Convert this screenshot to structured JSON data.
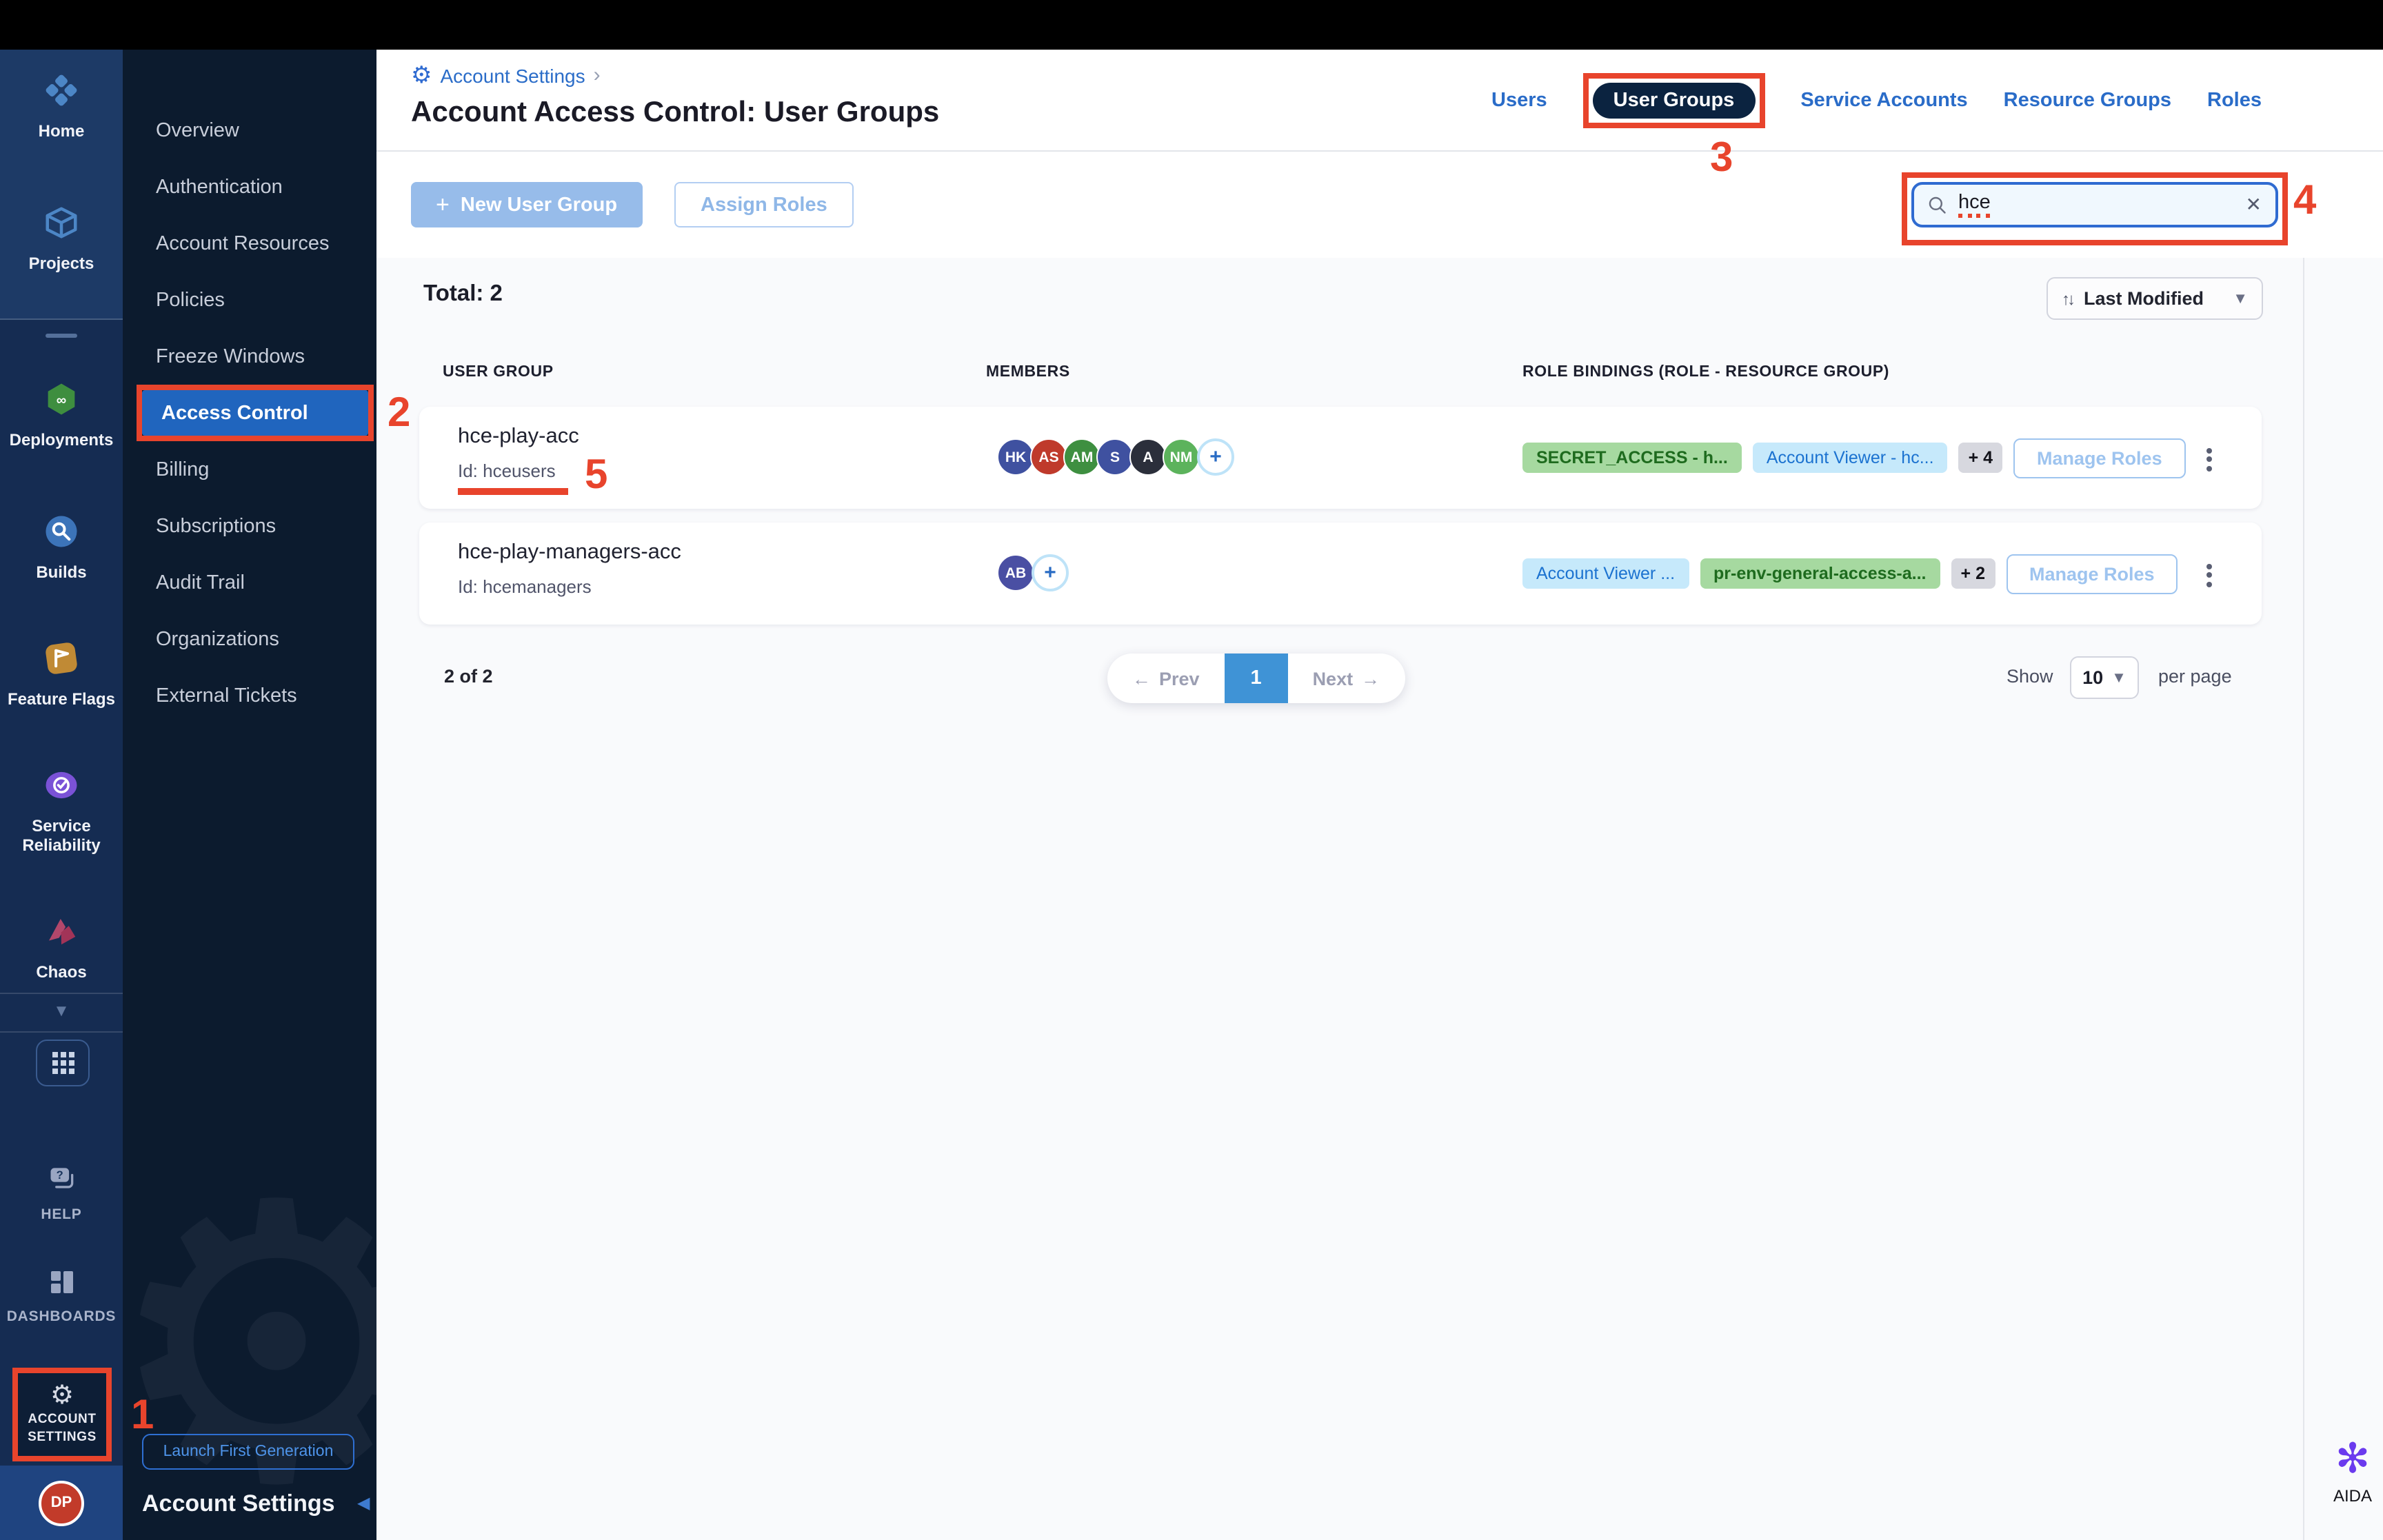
{
  "theme": {
    "annotation_red": "#E8442C",
    "accent_blue": "#2A6CC8",
    "selected_nav_blue": "#2065BE",
    "tab_pill_navy": "#0B2340",
    "chip_green_bg": "#A6D9A0",
    "chip_blue_bg": "#C6E9FB",
    "pagination_active_blue": "#3F93D6"
  },
  "primary_sidebar": {
    "top_items": [
      {
        "label": "Home",
        "icon": "home-icon"
      },
      {
        "label": "Projects",
        "icon": "projects-icon"
      }
    ],
    "module_items": [
      {
        "label": "Deployments",
        "icon": "deployments-icon"
      },
      {
        "label": "Builds",
        "icon": "builds-icon"
      },
      {
        "label": "Feature Flags",
        "icon": "feature-flags-icon"
      },
      {
        "label": "Service Reliability",
        "icon": "service-reliability-icon"
      },
      {
        "label": "Chaos",
        "icon": "chaos-icon"
      }
    ],
    "help_label": "HELP",
    "dashboards_label": "DASHBOARDS",
    "account_settings_label": "ACCOUNT SETTINGS",
    "user_initials": "DP"
  },
  "secondary_sidebar": {
    "items": [
      "Overview",
      "Authentication",
      "Account Resources",
      "Policies",
      "Freeze Windows",
      "Access Control",
      "Billing",
      "Subscriptions",
      "Audit Trail",
      "Organizations",
      "External Tickets"
    ],
    "selected_item": "Access Control",
    "launch_button_label": "Launch First Generation",
    "bottom_title": "Account Settings"
  },
  "header": {
    "breadcrumb": "Account Settings",
    "breadcrumb_separator": "›",
    "title": "Account Access Control: User Groups",
    "tabs": [
      "Users",
      "User Groups",
      "Service Accounts",
      "Resource Groups",
      "Roles"
    ],
    "selected_tab": "User Groups"
  },
  "toolbar": {
    "new_user_group_label": "New User Group",
    "assign_roles_label": "Assign Roles",
    "search_value": "hce"
  },
  "list": {
    "total_label": "Total: 2",
    "sort_label": "Last Modified",
    "columns": [
      "USER GROUP",
      "MEMBERS",
      "ROLE BINDINGS (ROLE - RESOURCE GROUP)"
    ],
    "rows": [
      {
        "name": "hce-play-acc",
        "id": "Id: hceusers",
        "members": [
          {
            "initials": "HK",
            "color": "#3F51A0"
          },
          {
            "initials": "AS",
            "color": "#BF3A2B"
          },
          {
            "initials": "AM",
            "color": "#3E8F40"
          },
          {
            "initials": "S",
            "color": "#3F51A0"
          },
          {
            "initials": "A",
            "color": "#2B2F3B"
          },
          {
            "initials": "NM",
            "color": "#5CB35C"
          }
        ],
        "role_chips": [
          {
            "label": "SECRET_ACCESS - h...",
            "style": "green"
          },
          {
            "label": "Account Viewer - hc...",
            "style": "blue"
          }
        ],
        "more_roles": "+ 4",
        "manage_label": "Manage Roles"
      },
      {
        "name": "hce-play-managers-acc",
        "id": "Id: hcemanagers",
        "members": [
          {
            "initials": "AB",
            "color": "#4A4FA3"
          }
        ],
        "role_chips": [
          {
            "label": "Account Viewer ...",
            "style": "blue"
          },
          {
            "label": "pr-env-general-access-a...",
            "style": "green"
          }
        ],
        "more_roles": "+ 2",
        "manage_label": "Manage Roles"
      }
    ]
  },
  "pagination": {
    "range_label": "2 of 2",
    "prev_label": "Prev",
    "next_label": "Next",
    "current_page": "1",
    "show_label": "Show",
    "page_size": "10",
    "per_page_label": "per page"
  },
  "aida_label": "AIDA",
  "annotations": {
    "step1": "1",
    "step2": "2",
    "step3": "3",
    "step4": "4",
    "step5": "5"
  }
}
